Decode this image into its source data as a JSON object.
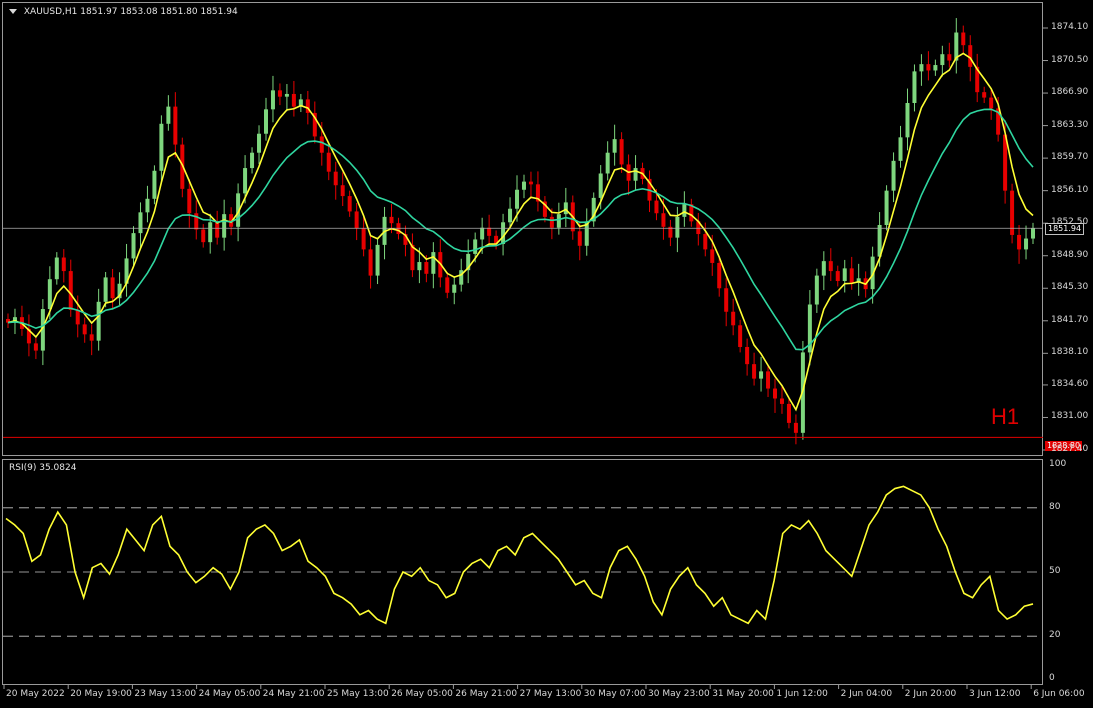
{
  "header": {
    "symbol": "XAUUSD,H1",
    "ohlc": "1851.97 1853.08 1851.80 1851.94"
  },
  "timeframe_label": "H1",
  "current_price": "1851.94",
  "red_line_price": "1828.80",
  "price_axis": [
    "1874.10",
    "1870.50",
    "1866.90",
    "1863.30",
    "1859.70",
    "1856.10",
    "1852.50",
    "1848.90",
    "1845.30",
    "1841.70",
    "1838.10",
    "1834.60",
    "1831.00",
    "1827.40"
  ],
  "rsi": {
    "title": "RSI(9) 35.0824",
    "levels": [
      "100",
      "80",
      "50",
      "20",
      "0"
    ]
  },
  "time_axis": [
    "20 May 2022",
    "20 May 19:00",
    "23 May 13:00",
    "24 May 05:00",
    "24 May 21:00",
    "25 May 13:00",
    "26 May 05:00",
    "26 May 21:00",
    "27 May 13:00",
    "30 May 07:00",
    "30 May 23:00",
    "31 May 20:00",
    "1 Jun 12:00",
    "2 Jun 04:00",
    "2 Jun 20:00",
    "3 Jun 12:00",
    "6 Jun 06:00"
  ],
  "colors": {
    "bull": "#7ed67e",
    "bear": "#e80000",
    "ma_fast": "#ffff33",
    "ma_slow": "#2fd6a0",
    "rsi_line": "#ffff33",
    "grid": "#c8c8c8"
  },
  "chart_data": {
    "type": "candlestick",
    "ylim": [
      1827.4,
      1874.1
    ],
    "closes": [
      1841.5,
      1842.1,
      1840.8,
      1839.2,
      1838.4,
      1843.0,
      1846.3,
      1848.7,
      1847.2,
      1842.9,
      1841.3,
      1840.2,
      1839.5,
      1843.8,
      1846.5,
      1844.2,
      1845.8,
      1848.6,
      1851.4,
      1853.7,
      1855.2,
      1858.3,
      1863.5,
      1865.4,
      1861.2,
      1856.3,
      1853.6,
      1851.8,
      1850.4,
      1852.6,
      1850.9,
      1853.5,
      1852.1,
      1855.8,
      1858.6,
      1860.3,
      1862.4,
      1865.1,
      1867.2,
      1866.5,
      1866.8,
      1865.4,
      1866.2,
      1864.7,
      1862.1,
      1860.3,
      1858.2,
      1856.7,
      1855.5,
      1853.8,
      1851.9,
      1849.6,
      1846.7,
      1850.1,
      1853.2,
      1852.5,
      1851.3,
      1850.1,
      1847.3,
      1848.2,
      1846.9,
      1849.3,
      1846.5,
      1844.8,
      1845.7,
      1847.3,
      1849.1,
      1850.7,
      1852.0,
      1851.1,
      1850.2,
      1852.6,
      1854.1,
      1856.2,
      1857.1,
      1856.8,
      1854.9,
      1853.2,
      1852.0,
      1853.5,
      1854.8,
      1851.6,
      1850.0,
      1852.7,
      1855.3,
      1858.0,
      1860.3,
      1861.8,
      1859.0,
      1857.2,
      1858.6,
      1857.4,
      1855.0,
      1853.6,
      1852.1,
      1850.9,
      1853.2,
      1854.6,
      1852.7,
      1851.3,
      1849.6,
      1848.1,
      1845.3,
      1842.7,
      1841.2,
      1838.8,
      1836.9,
      1835.3,
      1836.1,
      1834.2,
      1833.1,
      1832.5,
      1830.4,
      1829.3,
      1838.2,
      1843.5,
      1846.7,
      1848.3,
      1847.2,
      1846.1,
      1847.5,
      1845.9,
      1846.4,
      1845.2,
      1848.8,
      1852.3,
      1856.1,
      1859.4,
      1862.0,
      1865.8,
      1869.3,
      1870.1,
      1869.4,
      1870.0,
      1871.2,
      1870.5,
      1873.6,
      1872.2,
      1869.8,
      1867.0,
      1866.4,
      1865.2,
      1862.3,
      1856.1,
      1851.2,
      1849.6,
      1850.8,
      1851.94
    ],
    "rsi_values": [
      75,
      72,
      68,
      55,
      58,
      70,
      78,
      72,
      50,
      38,
      52,
      54,
      49,
      58,
      70,
      65,
      60,
      72,
      76,
      62,
      58,
      50,
      45,
      48,
      52,
      49,
      42,
      50,
      66,
      70,
      72,
      68,
      60,
      62,
      65,
      55,
      52,
      48,
      40,
      38,
      35,
      30,
      32,
      28,
      26,
      42,
      50,
      48,
      52,
      46,
      44,
      38,
      40,
      50,
      54,
      56,
      52,
      60,
      62,
      58,
      66,
      68,
      64,
      60,
      56,
      50,
      44,
      46,
      40,
      38,
      52,
      60,
      62,
      56,
      48,
      36,
      30,
      42,
      48,
      52,
      44,
      40,
      34,
      38,
      30,
      28,
      26,
      32,
      28,
      46,
      68,
      72,
      70,
      74,
      68,
      60,
      56,
      52,
      48,
      60,
      72,
      78,
      86,
      89,
      90,
      88,
      86,
      80,
      70,
      62,
      50,
      40,
      38,
      44,
      48,
      32,
      28,
      30,
      34,
      35.08
    ]
  }
}
